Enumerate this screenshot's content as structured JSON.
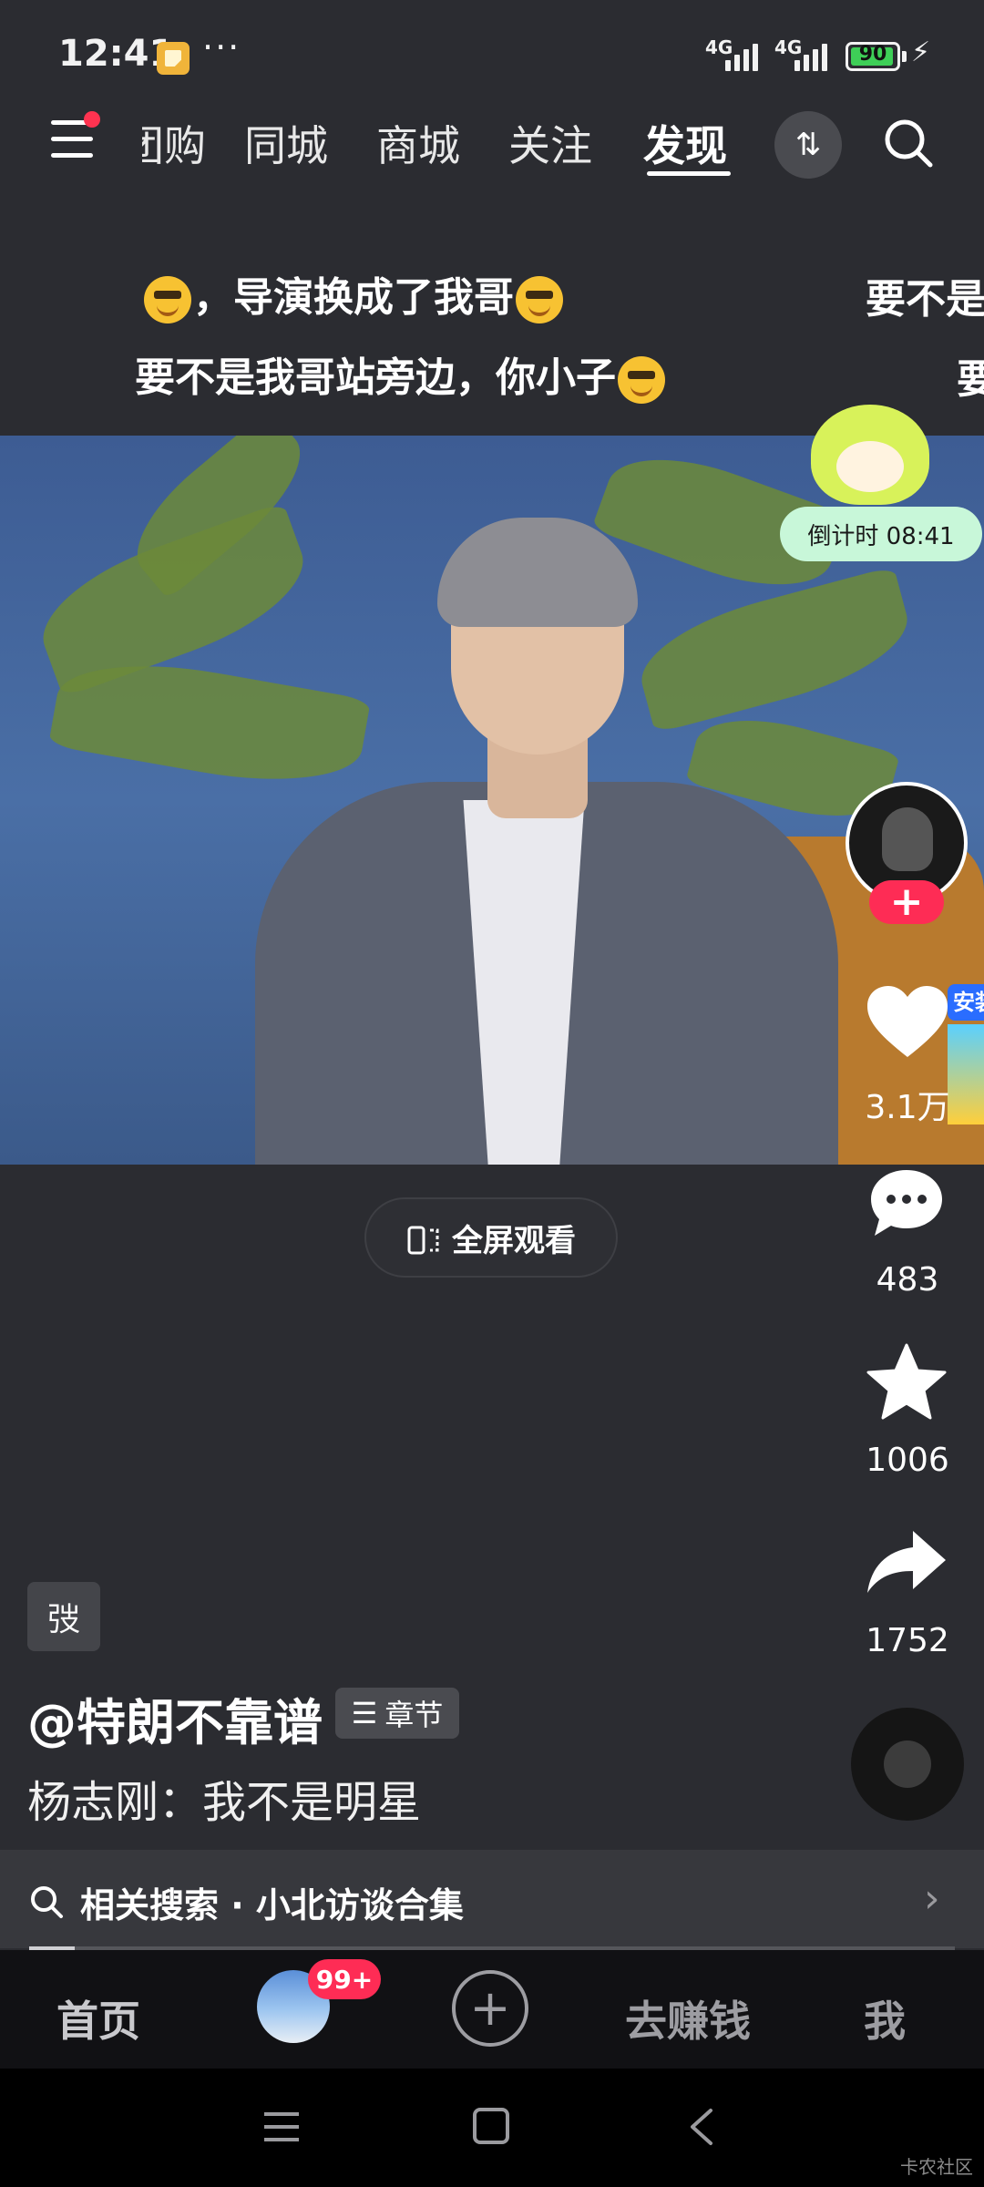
{
  "status_bar": {
    "time": "12:41",
    "dots": "···",
    "network1": "4G",
    "network2": "4G",
    "battery": "90"
  },
  "nav": {
    "tabs": [
      {
        "label": "团购"
      },
      {
        "label": "同城"
      },
      {
        "label": "商城"
      },
      {
        "label": "关注"
      },
      {
        "label": "发现",
        "active": true
      }
    ]
  },
  "danmaku": {
    "line1": "，导演换成了我哥",
    "line2": "要不是我哥站旁边，你小子",
    "right1": "要不是",
    "right2": "要"
  },
  "timer": {
    "label": "倒计时 08:41"
  },
  "fullscreen": {
    "label": "全屏观看"
  },
  "rail": {
    "likes": "3.1万",
    "comments": "483",
    "favorites": "1006",
    "shares": "1752",
    "ad_tag": "安装"
  },
  "caption": {
    "tag": "弢",
    "author": "@特朗不靠谱",
    "chapter_label": "章节",
    "description": "杨志刚：我不是明星"
  },
  "related": {
    "text": "相关搜索 · 小北访谈合集"
  },
  "tabbar": {
    "home": "首页",
    "badge": "99+",
    "earn": "去赚钱",
    "me": "我"
  },
  "watermark": "卡农社区"
}
